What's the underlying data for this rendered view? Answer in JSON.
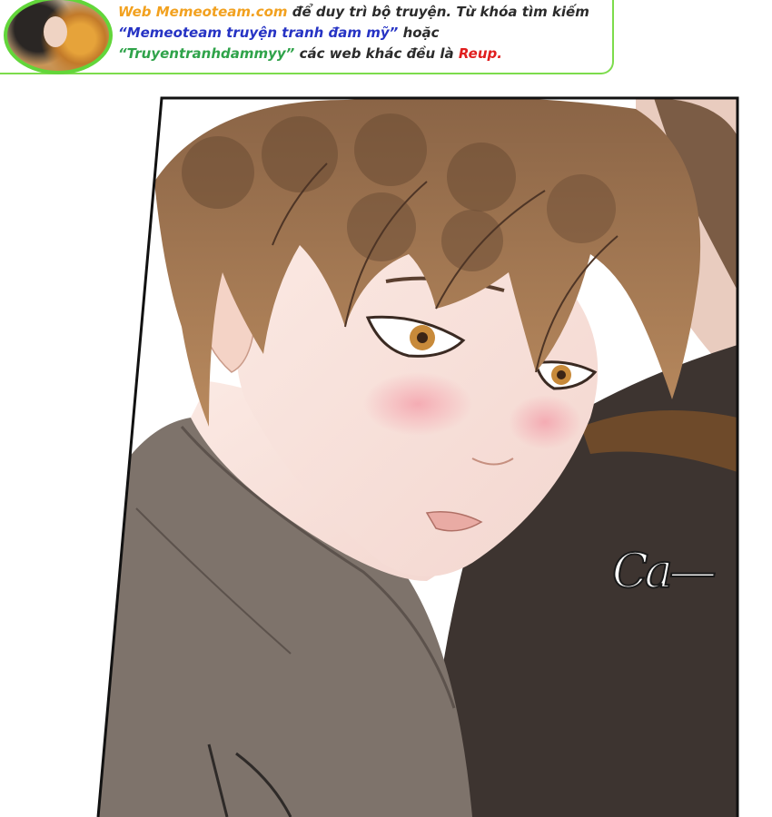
{
  "notice": {
    "line1_site": "Web Memeoteam.com",
    "line1_rest": " để duy trì bộ truyện. Từ khóa tìm kiếm",
    "line2_quote": "“Memeoteam truyện tranh đam mỹ”",
    "line2_rest": " hoặc",
    "line3_quote": "“Truyentranhdammyy”",
    "line3_rest": " các web khác đều là ",
    "line3_reup": "Reup."
  },
  "panel": {
    "sfx_text": "Ca—"
  },
  "colors": {
    "accent_green": "#62d63a",
    "site_orange": "#f2a11f",
    "keyword_blue": "#2633c4",
    "keyword_green": "#2fa34a",
    "reup_red": "#e01e1e"
  }
}
